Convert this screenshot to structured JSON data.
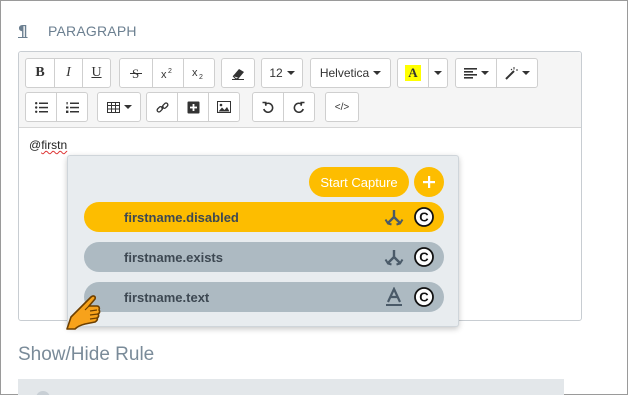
{
  "header": {
    "pilcrow": "¶",
    "title": "PARAGRAPH"
  },
  "toolbar": {
    "bold": "B",
    "italic": "I",
    "underline": "U",
    "font_size": "12",
    "font_family": "Helvetica",
    "color_letter": "A",
    "code_label": "</>"
  },
  "editor": {
    "prefix": "@",
    "typed_text": "firstn"
  },
  "autocomplete": {
    "capture_label": "Start Capture",
    "plus_label": "+",
    "items": [
      {
        "label": "firstname.disabled",
        "icon": "split-icon",
        "badge": "C",
        "state": "active"
      },
      {
        "label": "firstname.exists",
        "icon": "split-icon",
        "badge": "C",
        "state": "inactive"
      },
      {
        "label": "firstname.text",
        "icon": "text-icon",
        "badge": "C",
        "state": "inactive"
      }
    ]
  },
  "section": {
    "title": "Show/Hide Rule"
  },
  "colors": {
    "accent": "#fdbd00",
    "pill_inactive": "#adbac2",
    "text_muted": "#7a8b99",
    "highlight_yellow": "#ffff00"
  }
}
